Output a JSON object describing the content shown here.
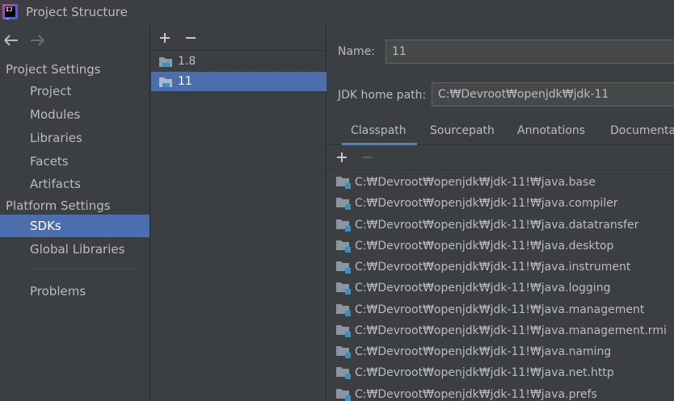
{
  "window": {
    "title": "Project Structure"
  },
  "nav": {
    "project_settings_header": "Project Settings",
    "project_items": [
      "Project",
      "Modules",
      "Libraries",
      "Facets",
      "Artifacts"
    ],
    "platform_settings_header": "Platform Settings",
    "platform_items": [
      "SDKs",
      "Global Libraries"
    ],
    "problems": "Problems",
    "selected": "SDKs"
  },
  "sdks": {
    "items": [
      "1.8",
      "11"
    ],
    "selected": "11"
  },
  "details": {
    "name_label": "Name:",
    "name_value": "11",
    "home_label": "JDK home path:",
    "home_value": "C:₩Devroot₩openjdk₩jdk-11",
    "tabs": [
      "Classpath",
      "Sourcepath",
      "Annotations",
      "Documenta"
    ],
    "active_tab": "Classpath",
    "classpath": [
      "C:₩Devroot₩openjdk₩jdk-11!₩java.base",
      "C:₩Devroot₩openjdk₩jdk-11!₩java.compiler",
      "C:₩Devroot₩openjdk₩jdk-11!₩java.datatransfer",
      "C:₩Devroot₩openjdk₩jdk-11!₩java.desktop",
      "C:₩Devroot₩openjdk₩jdk-11!₩java.instrument",
      "C:₩Devroot₩openjdk₩jdk-11!₩java.logging",
      "C:₩Devroot₩openjdk₩jdk-11!₩java.management",
      "C:₩Devroot₩openjdk₩jdk-11!₩java.management.rmi",
      "C:₩Devroot₩openjdk₩jdk-11!₩java.naming",
      "C:₩Devroot₩openjdk₩jdk-11!₩java.net.http",
      "C:₩Devroot₩openjdk₩jdk-11!₩java.prefs"
    ]
  },
  "colors": {
    "selection": "#4b6eaf",
    "background": "#3c3f41",
    "tab_underline": "#4a88c7",
    "jar_accent": "#3592c4"
  }
}
